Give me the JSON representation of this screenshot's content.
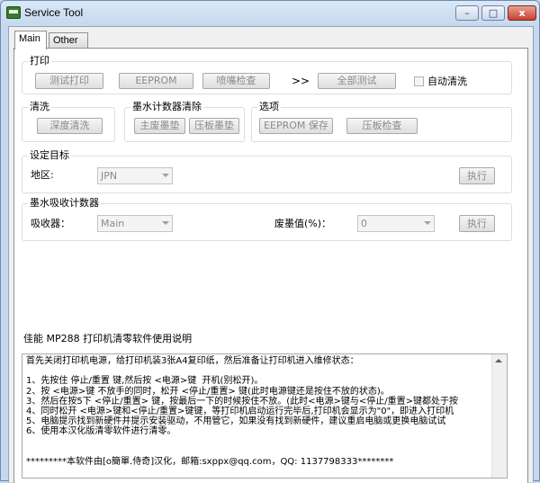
{
  "window": {
    "title": "Service Tool",
    "minimize_glyph": "–",
    "maximize_glyph": "□",
    "close_glyph": "x"
  },
  "tabs": [
    {
      "label": "Main"
    },
    {
      "label": "Other"
    }
  ],
  "print_group": {
    "title": "打印",
    "test_print": "测试打印",
    "eeprom": "EEPROM",
    "nozzle_check": "喷嘴检查",
    "arrows": ">>",
    "all_test": "全部测试",
    "auto_clean_label": "自动清洗"
  },
  "clean_group": {
    "title": "清洗",
    "deep_clean": "深度清洗"
  },
  "ink_counter_group": {
    "title": "墨水计数器清除",
    "main_waste": "主废墨垫",
    "platen_pad": "压板墨垫"
  },
  "options_group": {
    "title": "选项",
    "eeprom_save": "EEPROM 保存",
    "platen_check": "压板检查"
  },
  "destination_group": {
    "title": "设定目标",
    "region_label": "地区:",
    "region_value": "JPN",
    "execute": "执行"
  },
  "absorber_group": {
    "title": "墨水吸收计数器",
    "absorber_label": "吸收器：",
    "absorber_value": "Main",
    "waste_label": "废墨值(%)：",
    "waste_value": "0",
    "execute": "执行"
  },
  "instructions": {
    "title": "佳能 MP288 打印机清零软件使用说明",
    "text": "首先关闭打印机电源，给打印机装3张A4复印纸，然后准备让打印机进入维修状态：\n\n1、先按住 停止/重置 键,然后按 <电源>键  开机(别松开)。\n2、按 <电源>键 不放手的同时，松开 <停止/重置> 键(此时电源键还是按住不放的状态)。\n3、然后在按5下 <停止/重置> 键，按最后一下的时候按住不放。(此时<电源>键与<停止/重置>键都处于按\n4、同时松开 <电源>键和<停止/重置>键键，等打印机启动运行完毕后,打印机会显示为\"0\"，即进入打印机\n5、电脑提示找到新硬件并提示安装驱动，不用管它，如果没有找到新硬件，建议重启电脑或更换电脑试试\n6、使用本汉化版清零软件进行清零。\n\n\n*********本软件由[o簡單.侍奇]汉化，邮箱:sxppx@qq.com，QQ: 1137798333********"
  }
}
